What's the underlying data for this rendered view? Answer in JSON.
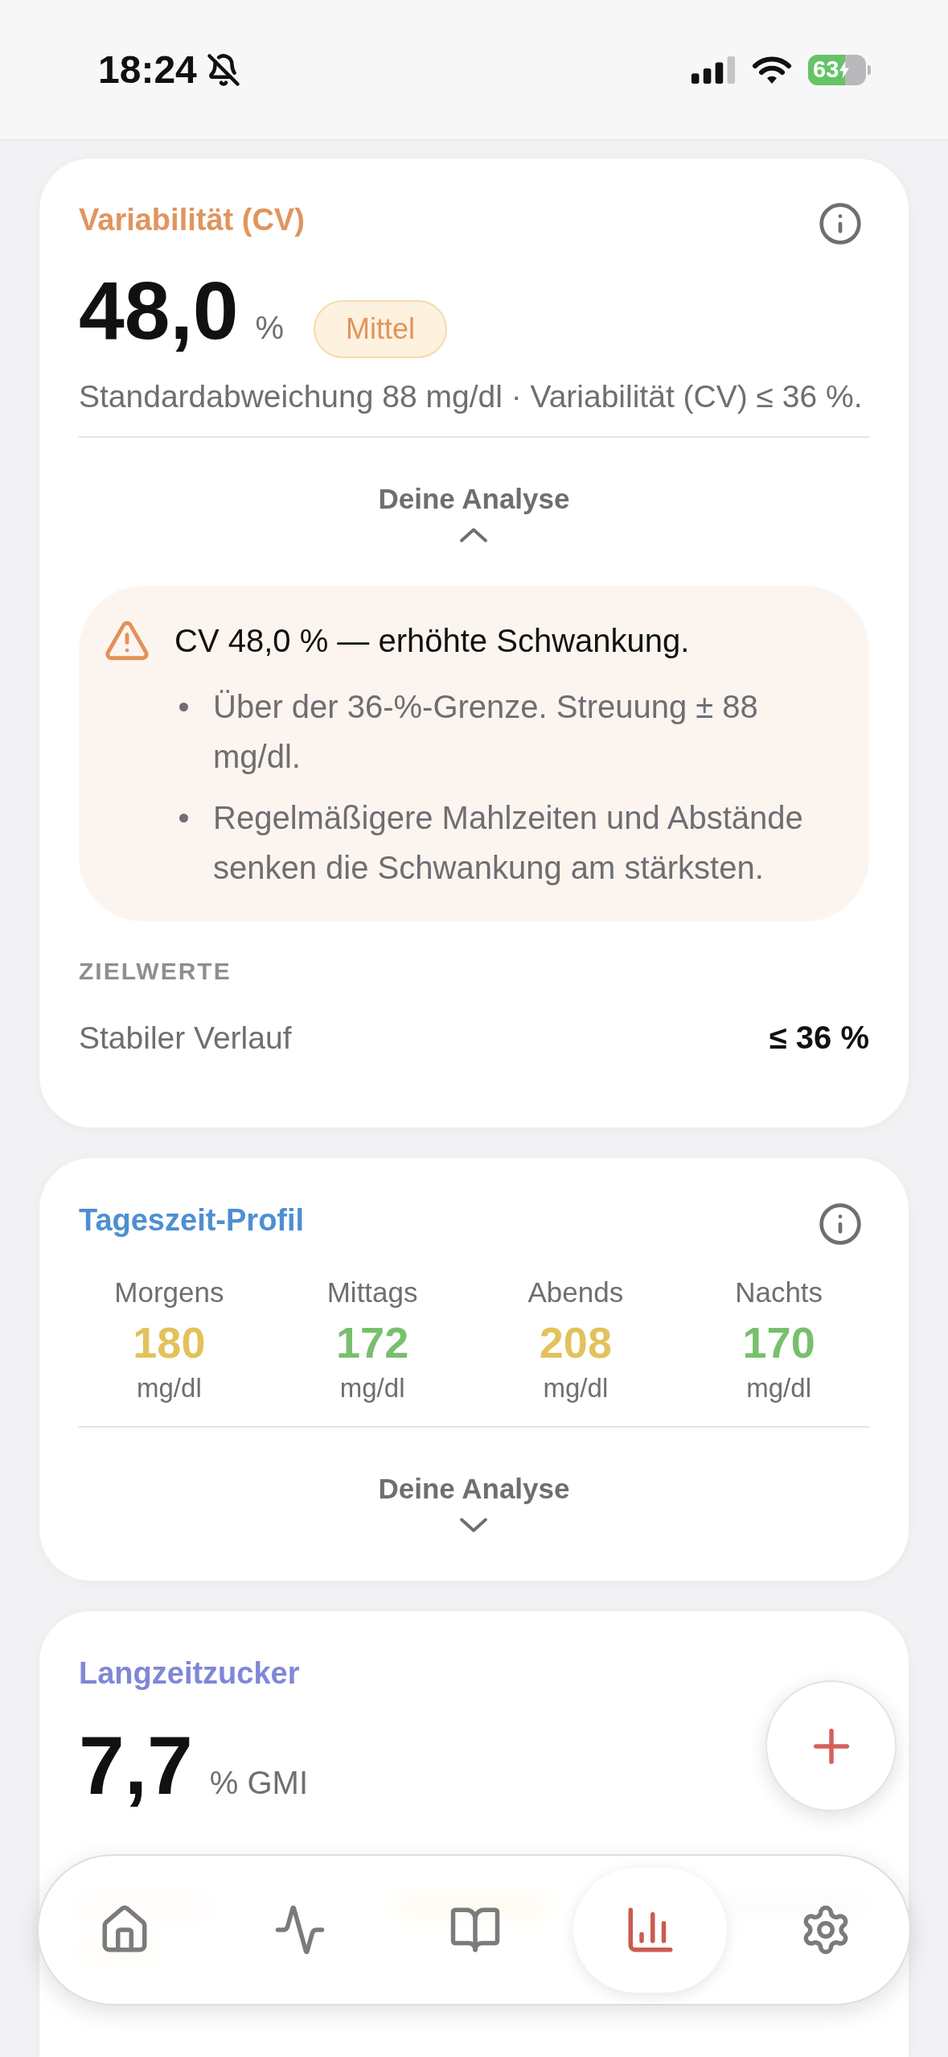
{
  "status_bar": {
    "time": "18:24",
    "battery": "63"
  },
  "cards": [
    {
      "kind": "variability",
      "title": "Variabilität (CV)",
      "color": "#e0955e",
      "value": "48,0",
      "unit": "%",
      "badge": "Mittel",
      "summary": "Standardabweichung 88 mg/dl · Variabilität (CV) ≤ 36 %.",
      "analysis": {
        "label": "Deine Analyse",
        "expanded": true,
        "headline": "CV 48,0 % — erhöhte Schwankung.",
        "bullets": [
          "Über der 36-%-Grenze. Streuung ± 88 mg/dl.",
          "Regelmäßigere Mahlzeiten und Abstände senken die Schwankung am stärksten."
        ]
      },
      "targets": {
        "heading": "ZIELWERTE",
        "rows": [
          {
            "label": "Stabiler Verlauf",
            "value": "≤ 36 %"
          }
        ]
      }
    },
    {
      "kind": "profile",
      "title": "Tageszeit-Profil",
      "color": "#4d8fd1",
      "slots": [
        {
          "label": "Morgens",
          "value": "180",
          "unit": "mg/dl",
          "color": "#e3c25c"
        },
        {
          "label": "Mittags",
          "value": "172",
          "unit": "mg/dl",
          "color": "#78bf6e"
        },
        {
          "label": "Abends",
          "value": "208",
          "unit": "mg/dl",
          "color": "#e3c25c"
        },
        {
          "label": "Nachts",
          "value": "170",
          "unit": "mg/dl",
          "color": "#78bf6e"
        }
      ],
      "analysis": {
        "label": "Deine Analyse",
        "expanded": false
      }
    },
    {
      "kind": "gmi",
      "title": "Langzeitzucker",
      "color": "#7f87d8",
      "value": "7,7",
      "unit": "% GMI"
    }
  ],
  "nav": {
    "items": [
      {
        "kind": "home",
        "selected": false
      },
      {
        "kind": "activity",
        "selected": false
      },
      {
        "kind": "journal",
        "selected": false
      },
      {
        "kind": "stats",
        "selected": true
      },
      {
        "kind": "settings",
        "selected": false
      }
    ]
  }
}
